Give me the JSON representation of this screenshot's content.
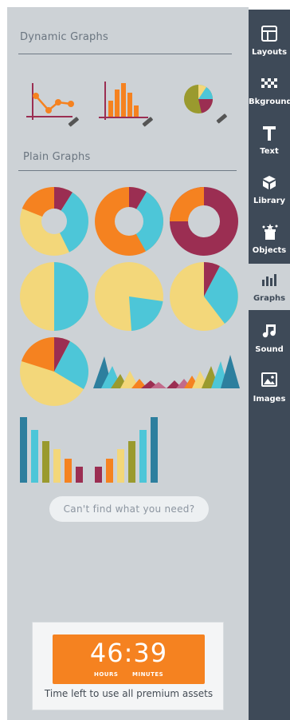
{
  "panel": {
    "dynamic_title": "Dynamic Graphs",
    "plain_title": "Plain Graphs",
    "search_text": "Can't find what you need?"
  },
  "timer": {
    "digits": "46:39",
    "hours_label": "HOURS",
    "minutes_label": "MINUTES",
    "caption": "Time left to use all premium assets"
  },
  "sidebar": {
    "items": [
      {
        "label": "Layouts",
        "icon": "layouts-icon"
      },
      {
        "label": "Bkground",
        "icon": "background-icon"
      },
      {
        "label": "Text",
        "icon": "text-icon"
      },
      {
        "label": "Library",
        "icon": "library-icon"
      },
      {
        "label": "Objects",
        "icon": "objects-icon"
      },
      {
        "label": "Graphs",
        "icon": "graphs-icon"
      },
      {
        "label": "Sound",
        "icon": "sound-icon"
      },
      {
        "label": "Images",
        "icon": "images-icon"
      }
    ],
    "active_item": "Graphs"
  },
  "colors": {
    "sidebar_bg": "#3e4a58",
    "panel_bg": "#cdd2d6",
    "orange": "#f58220",
    "yellow": "#f3d77a",
    "cyan": "#4dc6d8",
    "maroon": "#9b2e52",
    "teal": "#2d7f9e",
    "olive": "#9a9a2e"
  }
}
